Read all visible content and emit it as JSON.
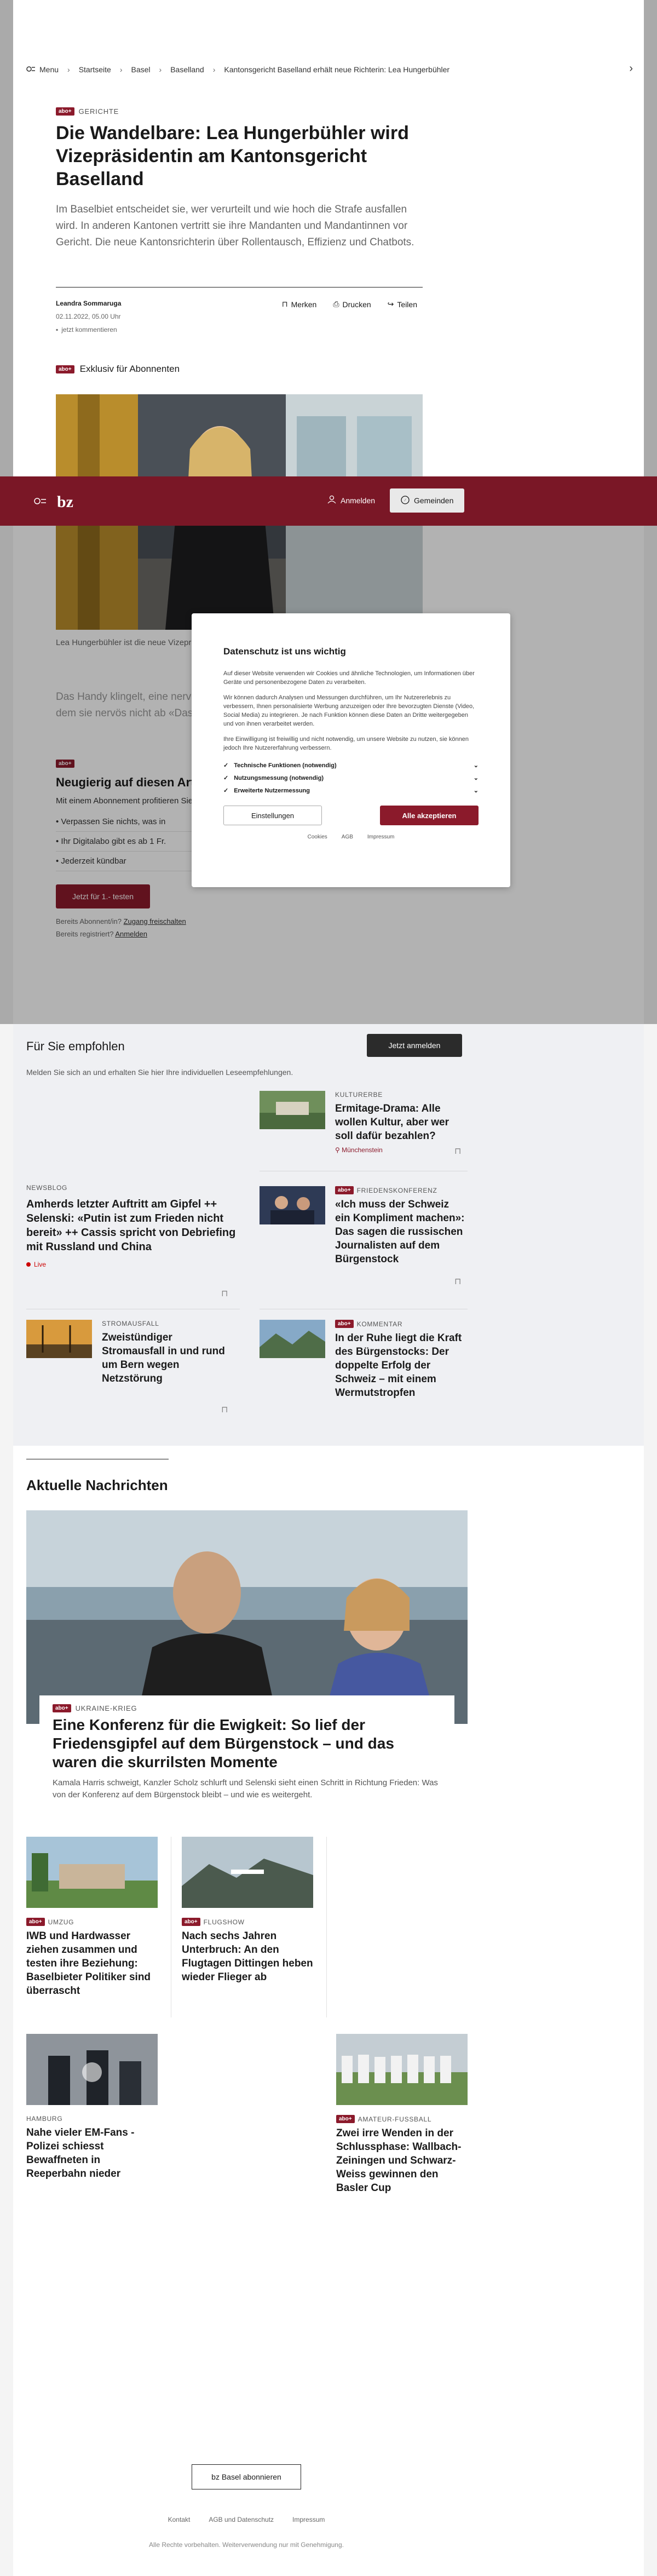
{
  "breadcrumb": {
    "menu": "Menu",
    "items": [
      "Startseite",
      "Basel",
      "Baselland",
      "Kantonsgericht Baselland erhält neue Richterin: Lea Hungerbühler"
    ]
  },
  "article": {
    "kicker": "Gerichte",
    "plus_badge": "abo+",
    "headline": "Die Wandelbare: Lea Hungerbühler wird Vizepräsidentin am Kantonsgericht Baselland",
    "lead": "Im Baselbiet entscheidet sie, wer verurteilt und wie hoch die Strafe ausfallen wird. In anderen Kantonen vertritt sie ihre Mandanten und Mandantinnen vor Gericht. Die neue Kantonsrichterin über Rollentausch, Effizienz und Chatbots.",
    "author": "Leandra Sommaruga",
    "date": "02.11.2022, 05.00 Uhr",
    "comments": "jetzt kommentieren",
    "actions": {
      "bookmark": "Merken",
      "print": "Drucken",
      "share": "Teilen"
    },
    "exclusive": "Exklusiv für Abonnenten",
    "caption": "Lea Hungerbühler ist die neue Vizepräsidentin am Kantonsgericht Baselland",
    "teaser": "Das Handy klingelt, eine nervöse Tonspur. Schnell sprintet sie vom Raum, in dem sie nervös nicht ab «Das war ein",
    "paywall": {
      "title": "Neugierig auf diesen Artikel?",
      "sub": "Mit einem Abonnement profitieren Sie von",
      "bullets": [
        "Verpassen Sie nichts, was in",
        "Ihr Digitalabo gibt es ab 1 Fr.",
        "Jederzeit kündbar"
      ],
      "button": "Jetzt für 1.- testen",
      "already_sub": "Bereits Abonnent/in?",
      "already_sub_link": "Zugang freischalten",
      "registered": "Bereits registriert?",
      "registered_link": "Anmelden"
    }
  },
  "sticky": {
    "logo": "bz",
    "login": "Anmelden",
    "municipalities": "Gemeinden"
  },
  "consent": {
    "title": "Datenschutz ist uns wichtig",
    "p1": "Auf dieser Website verwenden wir Cookies und ähnliche Technologien, um Informationen über Geräte und personenbezogene Daten zu verarbeiten.",
    "p2": "Wir können dadurch Analysen und Messungen durchführen, um Ihr Nutzererlebnis zu verbessern, Ihnen personalisierte Werbung anzuzeigen oder Ihre bevorzugten Dienste (Video, Social Media) zu integrieren. Je nach Funktion können diese Daten an Dritte weitergegeben und von ihnen verarbeitet werden.",
    "p3": "Ihre Einwilligung ist freiwillig und nicht notwendig, um unsere Website zu nutzen, sie können jedoch Ihre Nutzererfahrung verbessern.",
    "options": [
      "Technische Funktionen (notwendig)",
      "Nutzungsmessung (notwendig)",
      "Erweiterte Nutzermessung"
    ],
    "settings": "Einstellungen",
    "accept": "Alle akzeptieren",
    "links": [
      "Cookies",
      "AGB",
      "Impressum"
    ]
  },
  "recommended": {
    "title": "Für Sie empfohlen",
    "login_button": "Jetzt anmelden",
    "hint": "Melden Sie sich an und erhalten Sie hier Ihre individuellen Leseempfehlungen.",
    "items": [
      {
        "kicker": "Kulturerbe",
        "title": "Ermitage-Drama: Alle wollen Kultur, aber wer soll dafür bezahlen?",
        "location": "Münchenstein",
        "plus": false
      },
      {
        "kicker": "Friedenskonferenz",
        "title": "«Ich muss der Schweiz ein Kompliment machen»: Das sagen die russischen Journalisten auf dem Bürgenstock",
        "plus": true
      },
      {
        "kicker": "Newsblog",
        "title": "Amherds letzter Auftritt am Gipfel ++ Selenski: «Putin ist zum Frieden nicht bereit» ++ Cassis spricht von Debriefing mit Russland und China",
        "live": "Live",
        "plus": false
      },
      {
        "kicker": "Stromausfall",
        "title": "Zweistündiger Stromausfall in und rund um Bern wegen Netzstörung",
        "plus": false
      },
      {
        "kicker": "Kommentar",
        "title": "In der Ruhe liegt die Kraft des Bürgenstocks: Der doppelte Erfolg der Schweiz – mit einem Wermutstropfen",
        "plus": true
      }
    ]
  },
  "news": {
    "title": "Aktuelle Nachrichten",
    "lead": {
      "kicker": "Ukraine-Krieg",
      "title": "Eine Konferenz für die Ewigkeit: So lief der Friedensgipfel auf dem Bürgenstock – und das waren die skurrilsten Momente",
      "desc": "Kamala Harris schweigt, Kanzler Scholz schlurft und Selenski sieht einen Schritt in Richtung Frieden: Was von der Konferenz auf dem Bürgenstock bleibt – und wie es weitergeht."
    },
    "tiles": [
      {
        "kicker": "Umzug",
        "title": "IWB und Hardwasser ziehen zusammen und testen ihre Beziehung: Baselbieter Politiker sind überrascht",
        "plus": true
      },
      {
        "kicker": "Flugshow",
        "title": "Nach sechs Jahren Unterbruch: An den Flugtagen Dittingen heben wieder Flieger ab",
        "plus": true
      },
      {
        "kicker": "Hamburg",
        "title": "Nahe vieler EM-Fans - Polizei schiesst Bewaffneten in Reeperbahn nieder",
        "plus": false
      },
      {
        "kicker": "Amateur-Fussball",
        "title": "Zwei irre Wenden in der Schlussphase: Wallbach-Zeiningen und Schwarz-Weiss gewinnen den Basler Cup",
        "plus": true
      }
    ]
  },
  "footer": {
    "subscribe": "bz Basel abonnieren",
    "links": [
      "Kontakt",
      "AGB und Datenschutz",
      "Impressum"
    ],
    "copyright": "Alle Rechte vorbehalten. Weiterverwendung nur mit Genehmigung."
  },
  "colors": {
    "brand": "#7a1726",
    "plus": "#8b1a2b",
    "reco_bg": "#eff0f3"
  }
}
